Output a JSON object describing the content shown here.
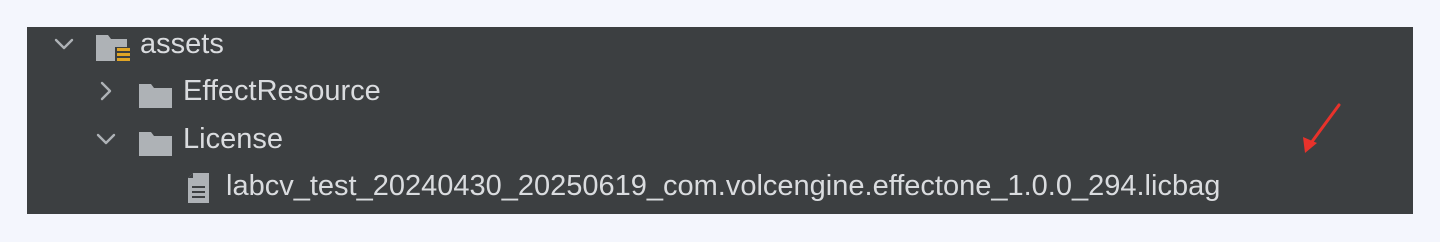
{
  "tree": {
    "items": [
      {
        "label": "assets",
        "icon": "assets-folder-icon",
        "expanded": true
      },
      {
        "label": "EffectResource",
        "icon": "folder-icon",
        "expanded": false
      },
      {
        "label": "License",
        "icon": "folder-icon",
        "expanded": true
      },
      {
        "label": "labcv_test_20240430_20250619_com.volcengine.effectone_1.0.0_294.licbag",
        "icon": "file-icon"
      }
    ]
  },
  "colors": {
    "panel_bg": "#3c3f41",
    "page_bg": "#f4f6fd",
    "text": "#dadcdf",
    "folder": "#aeb2b6",
    "resource_badge": "#e0a526",
    "annotation_arrow": "#e8322b"
  }
}
